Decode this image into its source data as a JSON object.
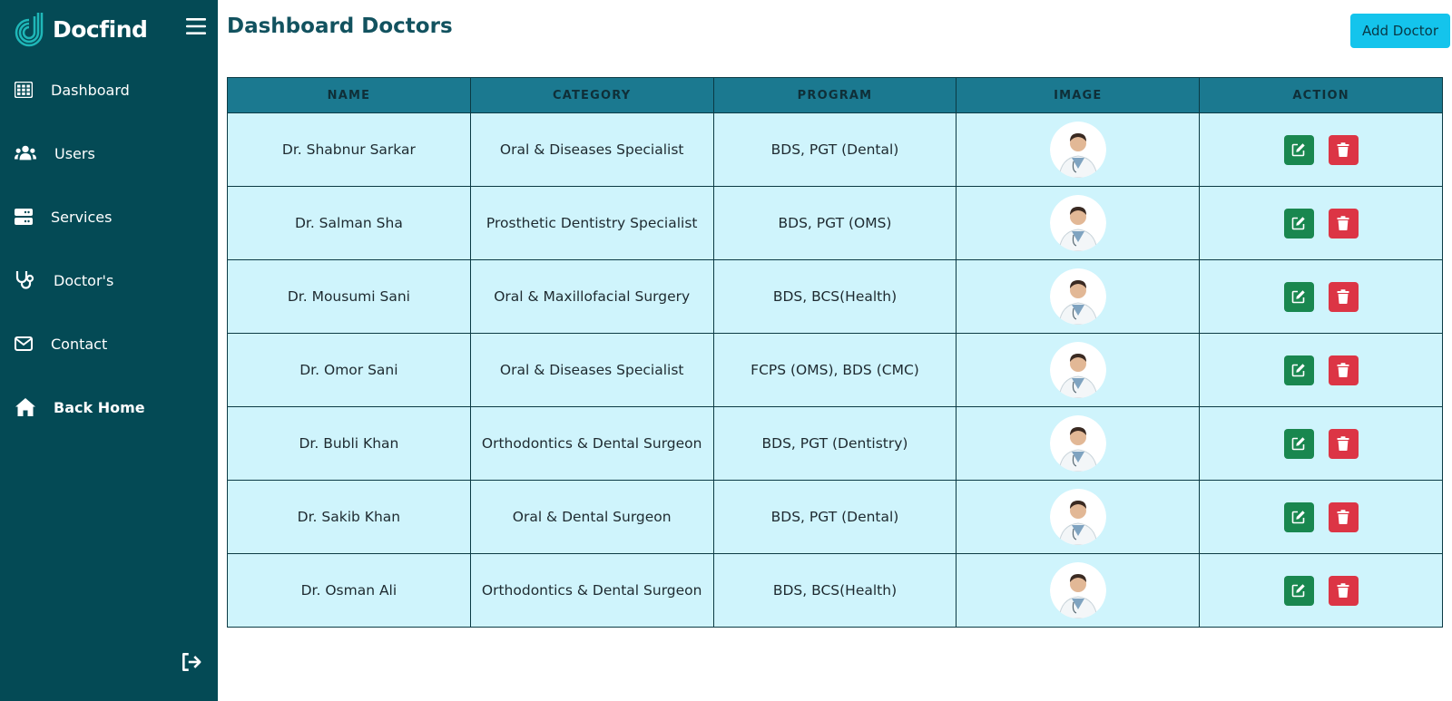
{
  "brand": {
    "name": "Docfind"
  },
  "sidebar": {
    "items": [
      {
        "label": "Dashboard",
        "icon": "table-grid-icon"
      },
      {
        "label": "Users",
        "icon": "users-icon"
      },
      {
        "label": "Services",
        "icon": "server-icon"
      },
      {
        "label": "Doctor's",
        "icon": "stethoscope-icon"
      },
      {
        "label": "Contact",
        "icon": "envelope-icon"
      },
      {
        "label": "Back Home",
        "icon": "home-icon"
      }
    ]
  },
  "header": {
    "title": "Dashboard Doctors",
    "add_label": "Add Doctor"
  },
  "table": {
    "columns": [
      "NAME",
      "CATEGORY",
      "PROGRAM",
      "IMAGE",
      "ACTION"
    ],
    "rows": [
      {
        "name": "Dr. Shabnur Sarkar",
        "category": "Oral & Diseases Specialist",
        "program": "BDS, PGT (Dental)"
      },
      {
        "name": "Dr. Salman Sha",
        "category": "Prosthetic Dentistry Specialist",
        "program": "BDS, PGT (OMS)"
      },
      {
        "name": "Dr. Mousumi Sani",
        "category": "Oral & Maxillofacial Surgery",
        "program": "BDS, BCS(Health)"
      },
      {
        "name": "Dr. Omor Sani",
        "category": "Oral & Diseases Specialist",
        "program": "FCPS (OMS), BDS (CMC)"
      },
      {
        "name": "Dr. Bubli Khan",
        "category": "Orthodontics & Dental Surgeon",
        "program": "BDS, PGT (Dentistry)"
      },
      {
        "name": "Dr. Sakib Khan",
        "category": "Oral & Dental Surgeon",
        "program": "BDS, PGT (Dental)"
      },
      {
        "name": "Dr. Osman Ali",
        "category": "Orthodontics & Dental Surgeon",
        "program": "BDS, BCS(Health)"
      }
    ]
  },
  "colors": {
    "sidebar_bg": "#044a55",
    "header_bg": "#1b7990",
    "row_bg": "#cff4fc",
    "add_button": "#14c4ec",
    "edit_button": "#19874f",
    "delete_button": "#dc3545",
    "title": "#12525f"
  }
}
